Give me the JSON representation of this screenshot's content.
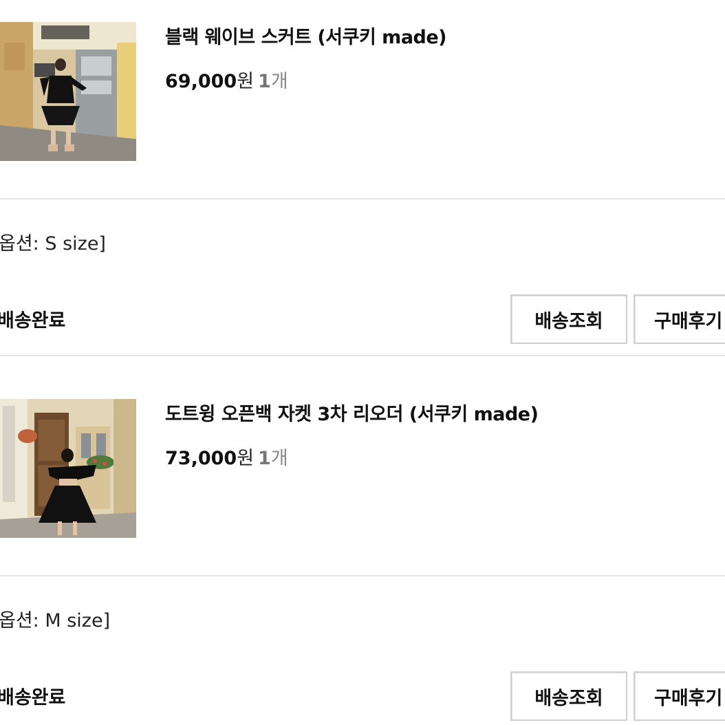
{
  "orders": [
    {
      "product_name": "블랙 웨이브 스커트 (서쿠키 made)",
      "price": "69,000",
      "price_unit": "원",
      "quantity": "1",
      "quantity_unit": "개",
      "option": "옵션: S size]",
      "status": "배송완료",
      "track_button": "배송조회",
      "review_button": "구매후기"
    },
    {
      "product_name": "도트윙 오픈백 자켓 3차 리오더 (서쿠키 made)",
      "price": "73,000",
      "price_unit": "원",
      "quantity": "1",
      "quantity_unit": "개",
      "option": "옵션: M size]",
      "status": "배송완료",
      "track_button": "배송조회",
      "review_button": "구매후기"
    }
  ]
}
